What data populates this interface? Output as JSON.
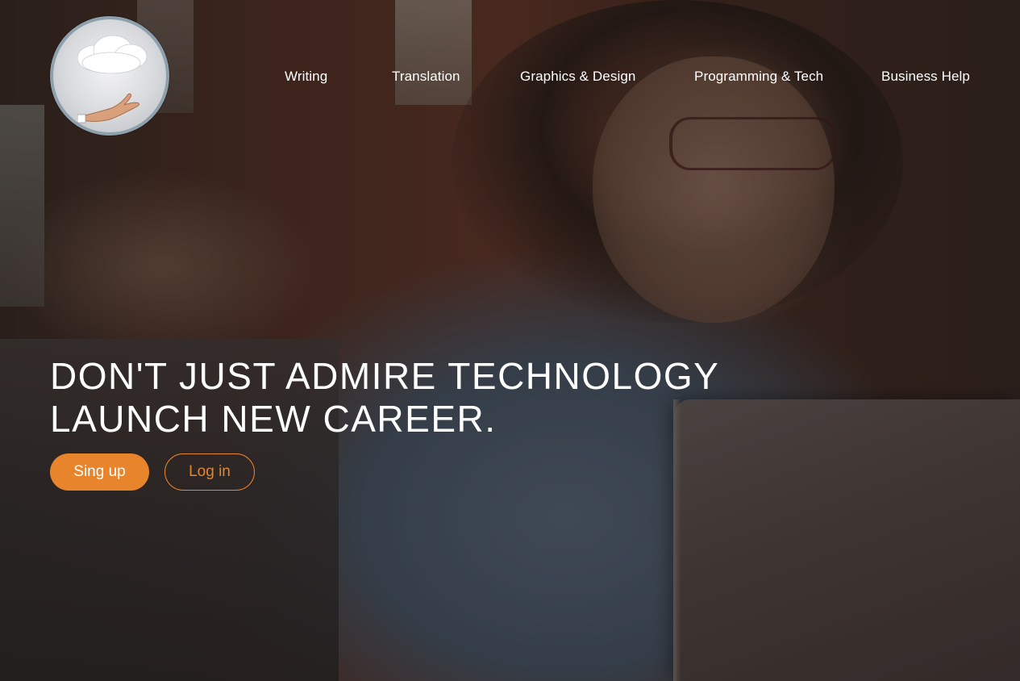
{
  "logo": {
    "icon": "cloud-over-hand-icon"
  },
  "nav": {
    "items": [
      {
        "label": "Writing"
      },
      {
        "label": "Translation"
      },
      {
        "label": "Graphics & Design"
      },
      {
        "label": "Programming & Tech"
      },
      {
        "label": "Business Help"
      }
    ]
  },
  "hero": {
    "headline_line1": "DON'T JUST ADMIRE TECHNOLOGY",
    "headline_line2": "LAUNCH NEW CAREER.",
    "signup_label": "Sing up",
    "login_label": "Log in"
  },
  "colors": {
    "accent": "#e8842c",
    "text": "#ffffff"
  }
}
